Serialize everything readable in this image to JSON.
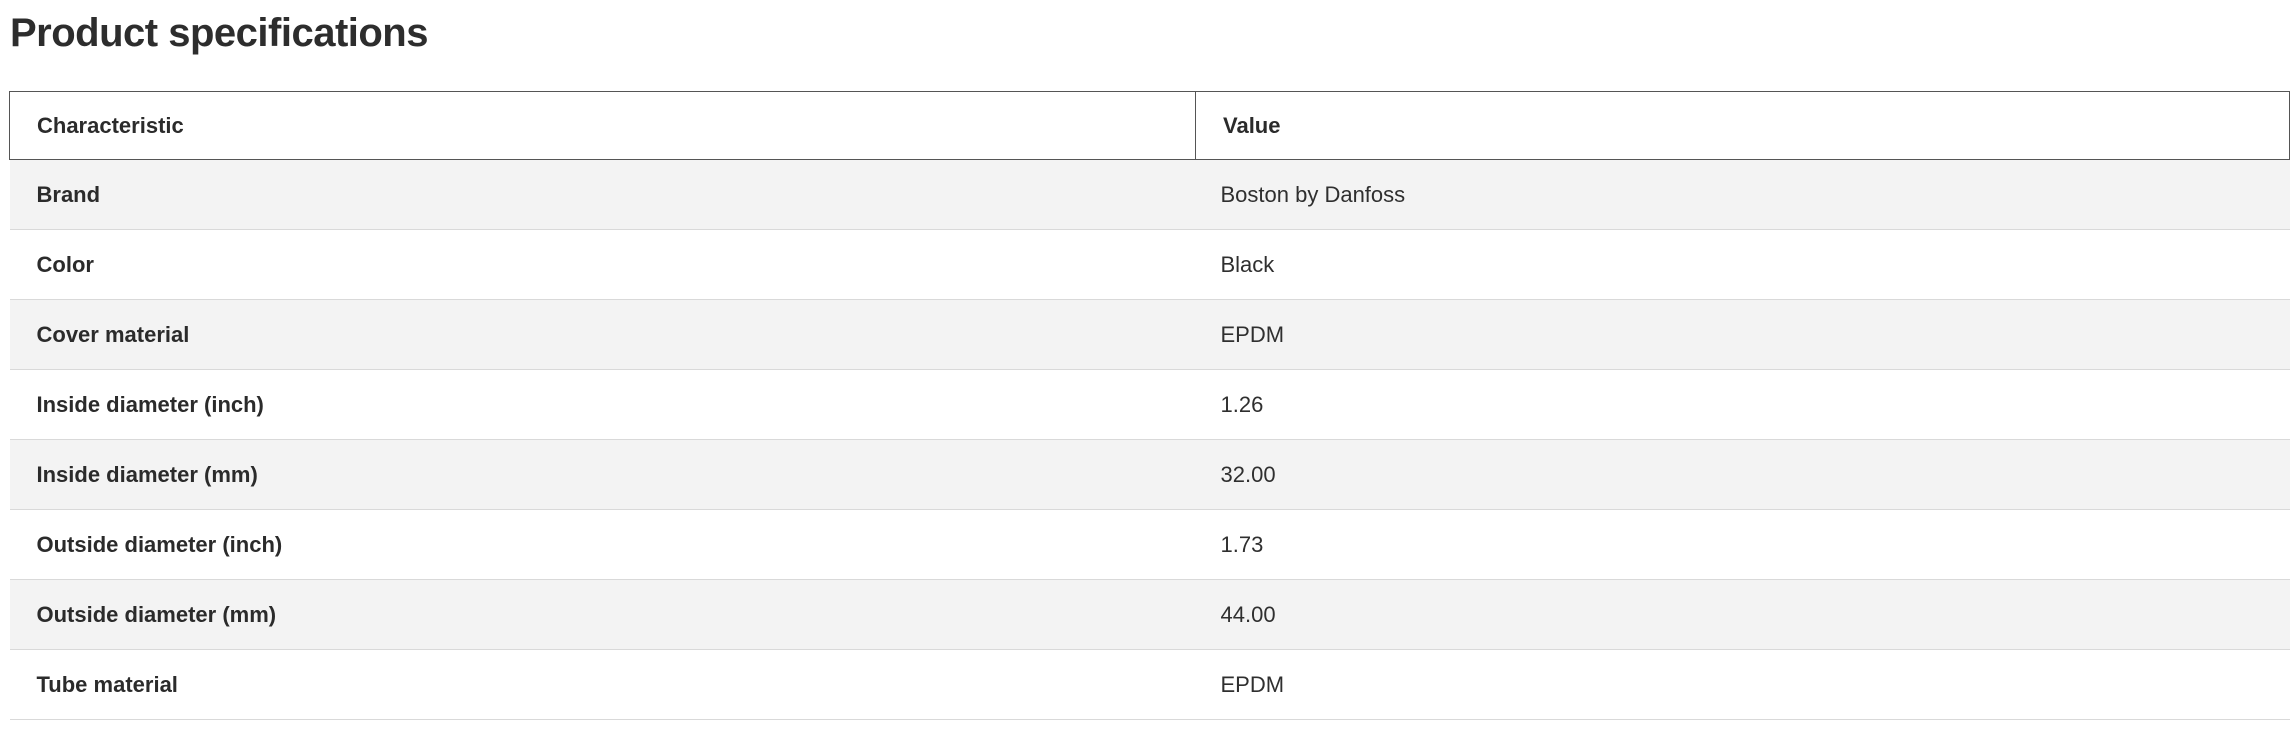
{
  "page": {
    "title": "Product specifications"
  },
  "table": {
    "headers": [
      "Characteristic",
      "Value"
    ],
    "rows": [
      {
        "characteristic": "Brand",
        "value": "Boston by Danfoss"
      },
      {
        "characteristic": "Color",
        "value": "Black"
      },
      {
        "characteristic": "Cover material",
        "value": "EPDM"
      },
      {
        "characteristic": "Inside diameter (inch)",
        "value": "1.26"
      },
      {
        "characteristic": "Inside diameter (mm)",
        "value": "32.00"
      },
      {
        "characteristic": "Outside diameter (inch)",
        "value": "1.73"
      },
      {
        "characteristic": "Outside diameter (mm)",
        "value": "44.00"
      },
      {
        "characteristic": "Tube material",
        "value": "EPDM"
      }
    ]
  },
  "colors": {
    "text": "#2b2b2b",
    "row_alt_background": "#f3f3f3",
    "header_border": "#555555",
    "row_divider": "#d9d9d9"
  }
}
